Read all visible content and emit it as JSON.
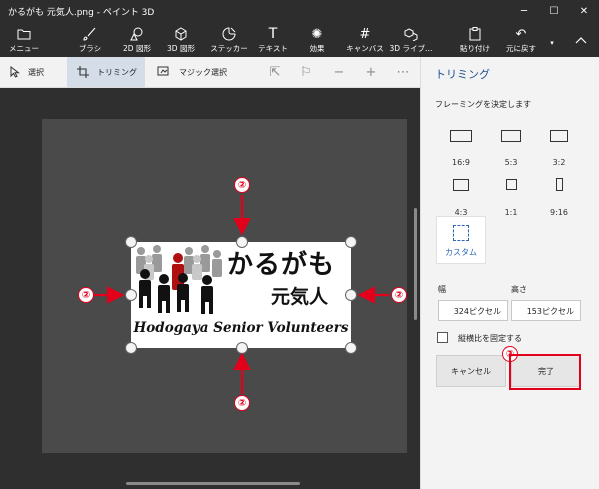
{
  "window": {
    "title": "かるがも 元気人.png - ペイント 3D"
  },
  "ribbon": {
    "menu": "メニュー",
    "brushes": "ブラシ",
    "shapes2d": "2D 図形",
    "shapes3d": "3D 図形",
    "stickers": "ステッカー",
    "text": "テキスト",
    "effects": "効果",
    "canvas": "キャンバス",
    "library3d": "3D ライブ…",
    "paste": "貼り付け",
    "undo": "元に戻す"
  },
  "toolstrip": {
    "select": "選択",
    "crop": "トリミング",
    "magic_select": "マジック選択"
  },
  "image": {
    "brand_main": "かるがも",
    "brand_sub": "元気人",
    "brand_en": "Hodogaya Senior Volunteers"
  },
  "annotations": {
    "arrow_step": "②",
    "done_step": "③"
  },
  "panel": {
    "title": "トリミング",
    "subtitle": "フレーミングを決定します",
    "ratios": [
      "16:9",
      "5:3",
      "3:2",
      "4:3",
      "1:1",
      "9:16"
    ],
    "custom_label": "カスタム",
    "width_label": "幅",
    "height_label": "高さ",
    "width_value": "324ピクセル",
    "height_value": "153ピクセル",
    "lock_ratio_label": "縦横比を固定する",
    "cancel_label": "キャンセル",
    "done_label": "完了"
  },
  "colors": {
    "accent": "#1e4f91",
    "annotation_red": "#e3001b"
  }
}
